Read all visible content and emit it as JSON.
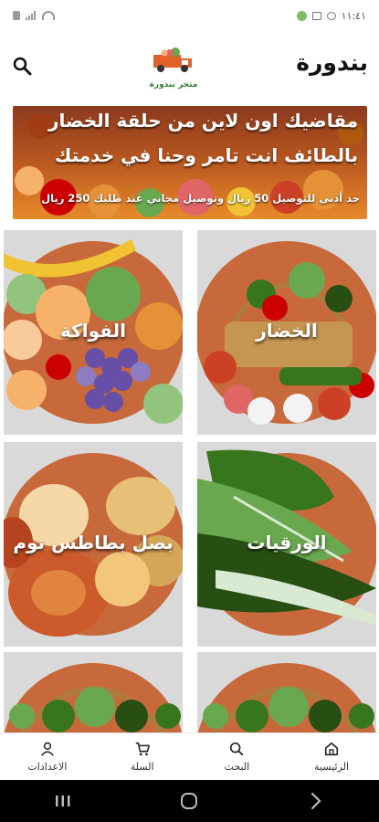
{
  "status_bar": {
    "time": "١١:٤١"
  },
  "header": {
    "title": "بندورة",
    "logo_text": "متجر بندورة"
  },
  "banner": {
    "line1": "مقاضيك اون لاين من حلقة الخضار",
    "line2": "بالطائف انت تامر وحنا في خدمتك",
    "note": "حد أدنى للتوصيل 50 ريال وتوصيل مجاني عند طلبك 250 ريال"
  },
  "categories": [
    {
      "label": "الخضار"
    },
    {
      "label": "الفواكة"
    },
    {
      "label": "الورقيات"
    },
    {
      "label": "بصل بطاطس توم"
    },
    {
      "label": ""
    },
    {
      "label": ""
    }
  ],
  "bottom_nav": {
    "home": "الرئيسية",
    "search": "البحث",
    "cart": "السلة",
    "settings": "الاعدادات"
  },
  "colors": {
    "card_bg": "#c8693c",
    "banner": "#b5541f",
    "brand": "#2e7d32"
  }
}
